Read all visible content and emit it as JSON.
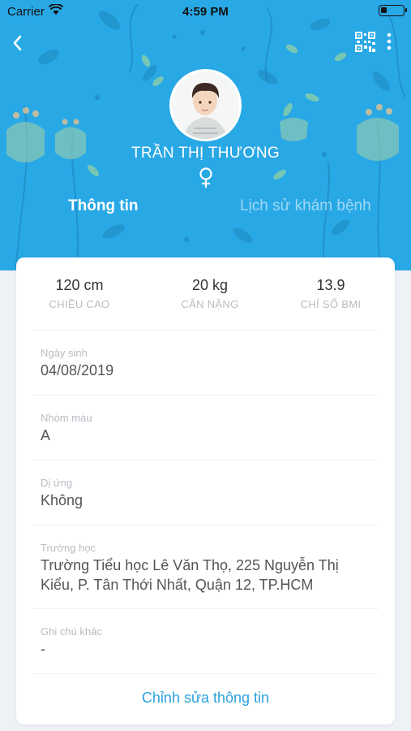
{
  "status_bar": {
    "carrier": "Carrier",
    "time": "4:59 PM"
  },
  "header": {
    "back_icon": "chevron-left-icon",
    "qr_icon": "qr-code-icon",
    "more_icon": "more-vertical-icon",
    "name": "TRẦN THỊ THƯƠNG",
    "gender_icon": "female-symbol-icon",
    "background_color": "#29a8e6"
  },
  "tabs": [
    {
      "label": "Thông tin",
      "active": true
    },
    {
      "label": "Lịch sử khám bệnh",
      "active": false
    }
  ],
  "stats": [
    {
      "value": "120 cm",
      "label": "CHIỀU CAO"
    },
    {
      "value": "20 kg",
      "label": "CÂN NẶNG"
    },
    {
      "value": "13.9",
      "label": "CHỈ SỐ BMI"
    }
  ],
  "fields": {
    "birthday": {
      "label": "Ngày sinh",
      "value": "04/08/2019"
    },
    "blood_type": {
      "label": "Nhóm máu",
      "value": "A"
    },
    "allergy": {
      "label": "Dị ứng",
      "value": "Không"
    },
    "school": {
      "label": "Trường học",
      "value": "Trường Tiểu học Lê Văn Thọ, 225 Nguyễn Thị Kiểu, P. Tân Thới Nhất, Quận 12, TP.HCM"
    },
    "notes": {
      "label": "Ghi chú khác",
      "value": "-"
    }
  },
  "actions": {
    "edit_label": "Chỉnh sửa thông tin"
  },
  "accent_color": "#2aa1dc"
}
